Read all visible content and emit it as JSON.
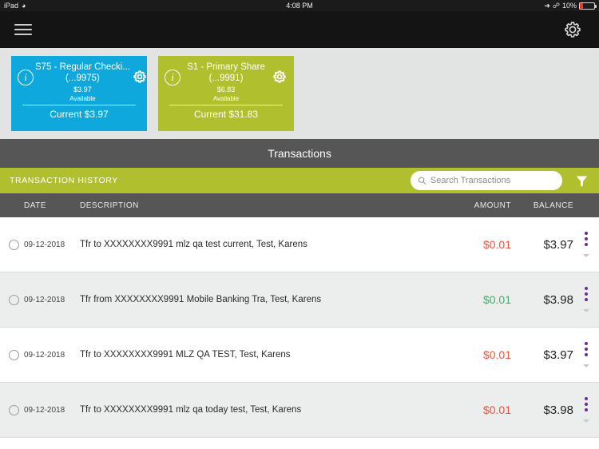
{
  "statusbar": {
    "device": "iPad",
    "wifi_icon": "wifi-icon",
    "time": "4:08 PM",
    "location_icon": "location-arrow-icon",
    "bluetooth_icon": "bluetooth-icon",
    "battery_percent": "10%"
  },
  "navbar": {
    "menu_icon": "hamburger-menu-icon",
    "settings_icon": "gear-icon"
  },
  "accounts": [
    {
      "info_icon": "info-circle-icon",
      "title": "S75 - Regular Checki...",
      "number": "(...9975)",
      "available_amount": "$3.97",
      "available_label": "Available",
      "current": "Current $3.97",
      "settings_icon": "gear-icon",
      "color": "#0fa8dc"
    },
    {
      "info_icon": "info-circle-icon",
      "title": "S1 - Primary  Share",
      "number": "(...9991)",
      "available_amount": "$6.83",
      "available_label": "Available",
      "current": "Current $31.83",
      "settings_icon": "gear-icon",
      "color": "#b0bf2e"
    }
  ],
  "section": {
    "title": "Transactions",
    "history_label": "TRANSACTION HISTORY",
    "search_placeholder": "Search Transactions",
    "search_value": "",
    "search_icon": "search-icon",
    "filter_icon": "filter-funnel-icon"
  },
  "table": {
    "headers": {
      "date": "DATE",
      "description": "DESCRIPTION",
      "amount": "AMOUNT",
      "balance": "BALANCE"
    },
    "rows": [
      {
        "date": "09-12-2018",
        "description": "Tfr to XXXXXXXX9991 mlz qa test current, Test, Karens",
        "amount": "$0.01",
        "amount_type": "debit",
        "balance": "$3.97",
        "menu_icon": "overflow-menu-icon",
        "expand_icon": "chevron-down-icon"
      },
      {
        "date": "09-12-2018",
        "description": "Tfr from XXXXXXXX9991 Mobile Banking Tra, Test, Karens",
        "amount": "$0.01",
        "amount_type": "credit",
        "balance": "$3.98",
        "menu_icon": "overflow-menu-icon",
        "expand_icon": "chevron-down-icon"
      },
      {
        "date": "09-12-2018",
        "description": "Tfr to XXXXXXXX9991 MLZ QA TEST, Test, Karens",
        "amount": "$0.01",
        "amount_type": "debit",
        "balance": "$3.97",
        "menu_icon": "overflow-menu-icon",
        "expand_icon": "chevron-down-icon"
      },
      {
        "date": "09-12-2018",
        "description": "Tfr to XXXXXXXX9991 mlz qa today test, Test, Karens",
        "amount": "$0.01",
        "amount_type": "debit",
        "balance": "$3.98",
        "menu_icon": "overflow-menu-icon",
        "expand_icon": "chevron-down-icon"
      }
    ]
  },
  "colors": {
    "accent_blue": "#0fa8dc",
    "accent_olive": "#b0bf2e",
    "debit": "#e8563f",
    "credit": "#3fae6a",
    "menu_purple": "#6b2d8f",
    "header_gray": "#565656"
  }
}
